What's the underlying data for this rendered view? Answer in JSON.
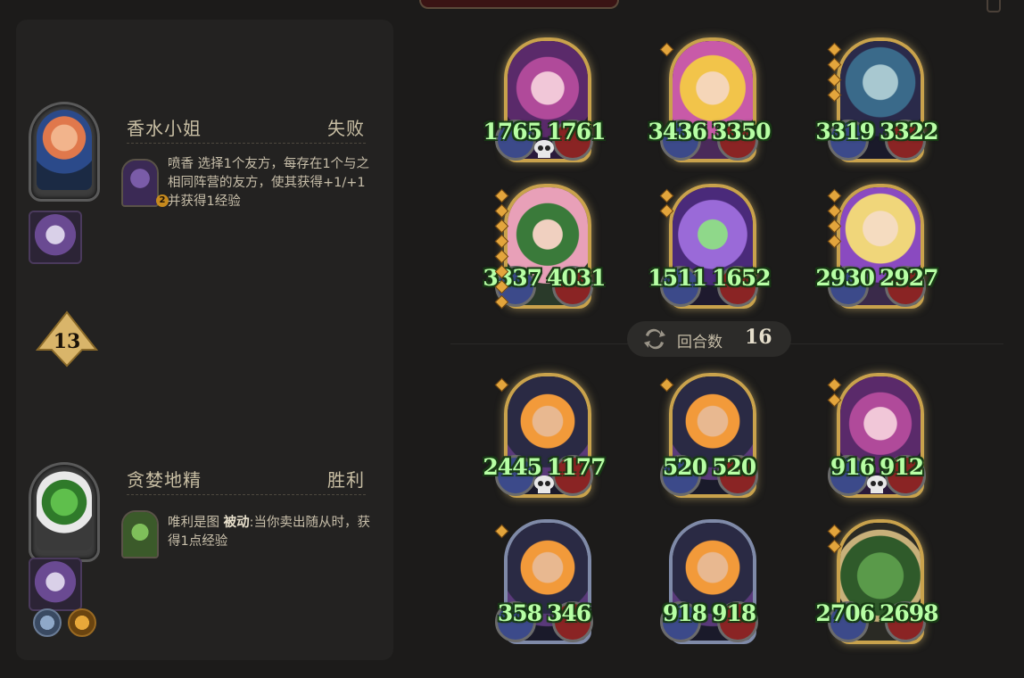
{
  "opponent": {
    "hero_name": "香水小姐",
    "result": "失败",
    "hero_power_name": "喷香",
    "hero_power_text": "选择1个友方，每存在1个与之相同阵营的友方，使其获得+1/+1并获得1经验",
    "hero_power_text_line1": "选择",
    "hero_power_bold": "+1/+1",
    "power_badge": "2"
  },
  "player": {
    "hero_name": "贪婪地精",
    "result": "胜利",
    "hero_power_name": "唯利是图",
    "hero_power_keyword": "被动",
    "hero_power_text": ":当你卖出随从时，获得1点经验"
  },
  "tavern_tier": "13",
  "round": {
    "label": "回合数",
    "value": "16"
  },
  "opponent_board": [
    {
      "attack": "1765",
      "health": "1761",
      "skull": true,
      "art": "pink-fairy"
    },
    {
      "attack": "3436",
      "health": "3350",
      "skull": false,
      "art": "blonde-girl"
    },
    {
      "attack": "3319",
      "health": "3322",
      "skull": false,
      "art": "blue-elf"
    },
    {
      "attack": "3337",
      "health": "4031",
      "skull": false,
      "art": "flower-fairy"
    },
    {
      "attack": "1511",
      "health": "1652",
      "skull": false,
      "art": "purple-flower-fairy"
    },
    {
      "attack": "2930",
      "health": "2927",
      "skull": false,
      "art": "blonde-elf"
    }
  ],
  "player_board": [
    {
      "attack": "2445",
      "health": "1177",
      "skull": true,
      "art": "moon-priestess"
    },
    {
      "attack": "520",
      "health": "520",
      "skull": false,
      "art": "moon-priestess"
    },
    {
      "attack": "916",
      "health": "912",
      "skull": true,
      "art": "pink-fairy"
    },
    {
      "attack": "358",
      "health": "346",
      "skull": false,
      "art": "moon-priestess"
    },
    {
      "attack": "918",
      "health": "918",
      "skull": false,
      "art": "moon-priestess"
    },
    {
      "attack": "2706",
      "health": "2698",
      "skull": false,
      "art": "green-dragon"
    }
  ],
  "colors": {
    "stat_text": "#b7ffa4",
    "gold_frame": "#c9a24c",
    "panel": "#232221",
    "background": "#1c1b1a"
  }
}
